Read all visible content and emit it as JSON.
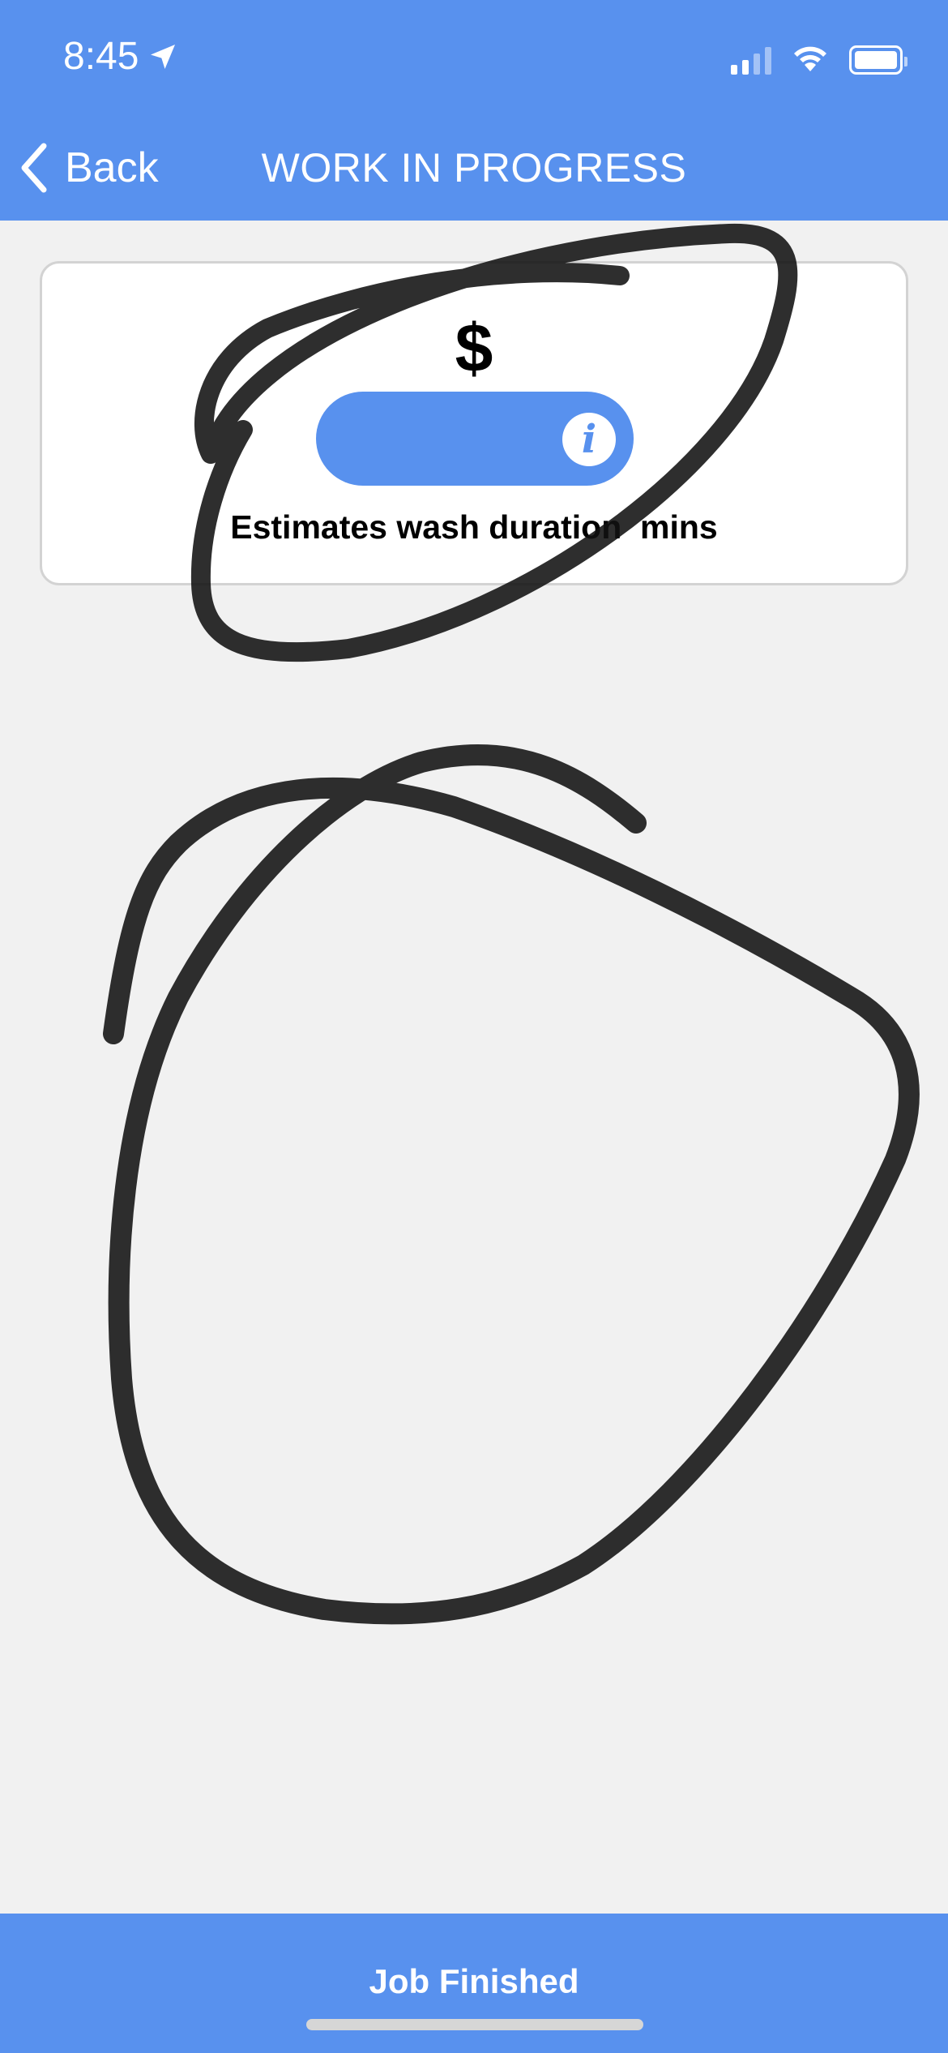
{
  "status_bar": {
    "time": "8:45",
    "location_icon": "location-arrow-icon",
    "signal_icon": "cellular-signal-icon",
    "wifi_icon": "wifi-icon",
    "battery_icon": "battery-icon"
  },
  "nav": {
    "back_label": "Back",
    "back_icon": "chevron-left-icon",
    "title": "WORK IN PROGRESS"
  },
  "card": {
    "price": "$",
    "info_icon": "info-icon",
    "info_glyph": "i",
    "duration_text": "Estimates wash duration  mins"
  },
  "footer": {
    "button_label": "Job Finished"
  },
  "colors": {
    "accent": "#5891ee",
    "background": "#f1f1f1",
    "card_border": "#d3d3d3",
    "scribble": "#111111"
  }
}
